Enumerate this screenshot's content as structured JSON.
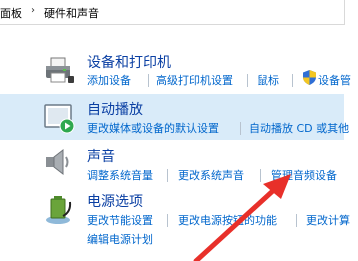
{
  "breadcrumb": {
    "items": [
      "面板",
      "硬件和声音"
    ],
    "separator_icon": "chevron-right"
  },
  "categories": [
    {
      "id": "devices-printers",
      "title": "设备和打印机",
      "links": [
        "添加设备",
        "高级打印机设置",
        "鼠标",
        "设备管"
      ],
      "shield_on_link": 3,
      "highlighted": false
    },
    {
      "id": "autoplay",
      "title": "自动播放",
      "links": [
        "更改媒体或设备的默认设置",
        "自动播放 CD 或其他"
      ],
      "highlighted": true
    },
    {
      "id": "sound",
      "title": "声音",
      "links": [
        "调整系统音量",
        "更改系统声音",
        "管理音频设备"
      ],
      "highlighted": false
    },
    {
      "id": "power",
      "title": "电源选项",
      "links": [
        "更改节能设置",
        "更改电源按钮的功能",
        "更改计算"
      ],
      "links_row2": [
        "编辑电源计划"
      ],
      "highlighted": false
    }
  ],
  "annotation": {
    "arrow_color": "#e8302a"
  },
  "colors": {
    "link": "#0066cc",
    "title": "#0a3fa3",
    "highlight_bg": "#d9ebf9"
  }
}
